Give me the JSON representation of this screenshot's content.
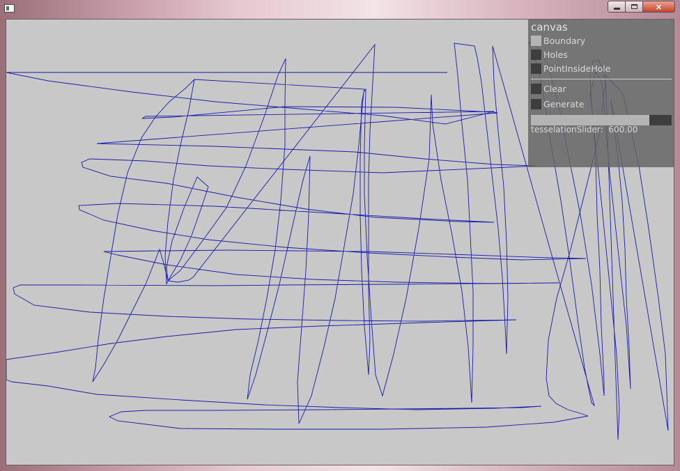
{
  "window": {
    "icon": "app-window-icon",
    "buttons": {
      "minimize": "minimize-icon",
      "maximize": "maximize-icon",
      "close": "×"
    }
  },
  "gui": {
    "title": "canvas",
    "toggles": [
      {
        "label": "Boundary",
        "checked": true
      },
      {
        "label": "Holes",
        "checked": false
      },
      {
        "label": "PointInsideHole",
        "checked": false
      }
    ],
    "buttons": [
      {
        "label": "Clear"
      },
      {
        "label": "Generate"
      }
    ],
    "slider": {
      "label": "tesselationSlider:",
      "value": "600.00",
      "fraction": 0.84
    }
  },
  "colors": {
    "canvas_bg": "#c8c8c8",
    "stroke": "#1a1aa8",
    "panel_bg": "#666666",
    "toggle_on": "#b4b4b4",
    "toggle_off": "#3e3e3e"
  }
}
